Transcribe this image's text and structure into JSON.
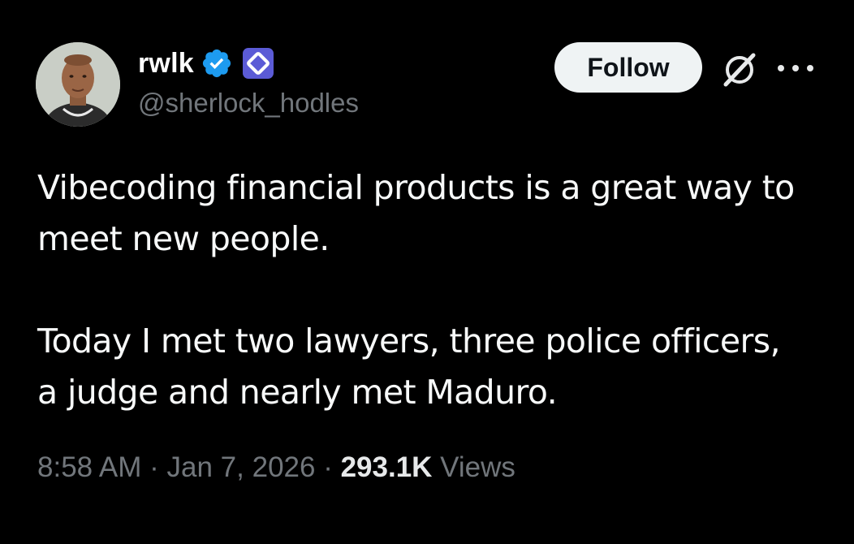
{
  "author": {
    "display_name": "rwlk",
    "handle": "@sherlock_hodles",
    "verified_icon": "verified-badge-icon",
    "affiliate_icon": "affiliate-badge-icon"
  },
  "actions": {
    "follow_label": "Follow",
    "grok_icon": "grok-icon",
    "more_icon": "more-options-icon"
  },
  "tweet": {
    "line1": "Vibecoding financial products is a great way to",
    "line2": "meet new people.",
    "line3": "Today I met two lawyers, three police officers,",
    "line4": "a judge and nearly met Maduro."
  },
  "meta": {
    "time": "8:58 AM",
    "sep1": " · ",
    "date": "Jan 7, 2026",
    "sep2": " · ",
    "views_count": "293.1K",
    "views_label": " Views"
  },
  "colors": {
    "background": "#000000",
    "verified": "#1d9bf0",
    "affiliate_badge": "#5b5bd6",
    "muted_text": "#71767b"
  }
}
